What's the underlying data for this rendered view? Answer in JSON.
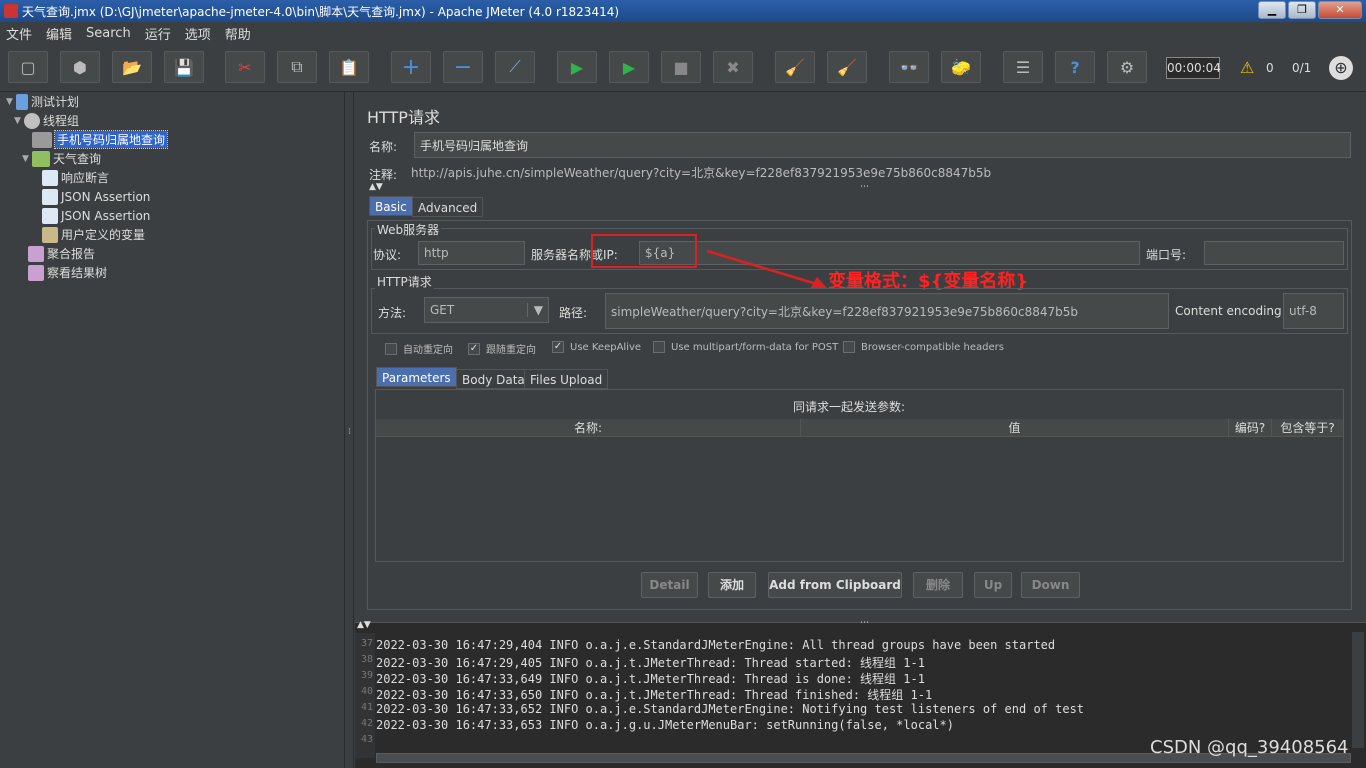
{
  "window": {
    "title": "天气查询.jmx (D:\\GJ\\jmeter\\apache-jmeter-4.0\\bin\\脚本\\天气查询.jmx) - Apache JMeter (4.0 r1823414)",
    "min_label": "▁",
    "max_label": "❐",
    "close_label": "✕"
  },
  "menu": {
    "items": [
      "文件",
      "编辑",
      "Search",
      "运行",
      "选项",
      "帮助"
    ]
  },
  "toolbar": {
    "icons": [
      "new-icon",
      "templates-icon",
      "open-icon",
      "save-icon",
      "cut-icon",
      "copy-icon",
      "paste-icon",
      "expand-icon",
      "collapse-icon",
      "toggle-icon",
      "start-icon",
      "start-no-pause-icon",
      "stop-icon",
      "shutdown-icon",
      "clear-icon",
      "clear-all-icon",
      "search-icon",
      "reset-search-icon",
      "function-helper-icon",
      "help-icon",
      "remote-icon"
    ],
    "glyphs": [
      "▢",
      "⬢",
      "📂",
      "💾",
      "✂",
      "⧉",
      "📋",
      "+",
      "−",
      "⟋",
      "▶",
      "▶",
      "■",
      "✖",
      "🧹",
      "🧹",
      "👓",
      "🧽",
      "☰",
      "?",
      "⚙"
    ],
    "timer": "00:00:04",
    "warning_count": "0",
    "thread_count": "0/1",
    "warning_glyph": "⚠",
    "globe_glyph": "⊕"
  },
  "tree": {
    "nodes": [
      {
        "label": "测试计划",
        "toggle": "▼",
        "color": "#6aa0e0"
      },
      {
        "label": "线程组",
        "toggle": "▼",
        "color": "#c0c0c0"
      },
      {
        "label": "手机号码归属地查询",
        "toggle": "",
        "color": "#9a9a9a"
      },
      {
        "label": "天气查询",
        "toggle": "▼",
        "color": "#8fbf5f"
      },
      {
        "label": "响应断言",
        "toggle": "",
        "color": "#dde8f5"
      },
      {
        "label": "JSON Assertion",
        "toggle": "",
        "color": "#dde8f5"
      },
      {
        "label": "JSON Assertion",
        "toggle": "",
        "color": "#dde8f5"
      },
      {
        "label": "用户定义的变量",
        "toggle": "",
        "color": "#c9b88a"
      },
      {
        "label": "聚合报告",
        "toggle": "",
        "color": "#c9a0d0"
      },
      {
        "label": "察看结果树",
        "toggle": "",
        "color": "#c9a0d0"
      }
    ]
  },
  "panel": {
    "heading": "HTTP请求",
    "name_label": "名称:",
    "name_value": "手机号码归属地查询",
    "comment_label": "注释:",
    "comment_value": "http://apis.juhe.cn/simpleWeather/query?city=北京&key=f228ef837921953e9e75b860c8847b5b",
    "tabs": [
      "Basic",
      "Advanced"
    ],
    "web_server": {
      "title": "Web服务器",
      "protocol_label": "协议:",
      "protocol_value": "http",
      "server_label": "服务器名称或IP:",
      "server_value": "${a}",
      "port_label": "端口号:",
      "port_value": ""
    },
    "http_request": {
      "title": "HTTP请求",
      "method_label": "方法:",
      "method_value": "GET",
      "path_label": "路径:",
      "path_value": "simpleWeather/query?city=北京&key=f228ef837921953e9e75b860c8847b5b",
      "encoding_label": "Content encoding:",
      "encoding_value": "utf-8"
    },
    "checkboxes": [
      {
        "label": "自动重定向",
        "checked": false
      },
      {
        "label": "跟随重定向",
        "checked": true
      },
      {
        "label": "Use KeepAlive",
        "checked": true
      },
      {
        "label": "Use multipart/form-data for POST",
        "checked": false
      },
      {
        "label": "Browser-compatible headers",
        "checked": false
      }
    ],
    "param_tabs": [
      "Parameters",
      "Body Data",
      "Files Upload"
    ],
    "params_caption": "同请求一起发送参数:",
    "columns": [
      "名称:",
      "值",
      "编码?",
      "包含等于?"
    ],
    "buttons": [
      "Detail",
      "添加",
      "Add from Clipboard",
      "删除",
      "Up",
      "Down"
    ],
    "annotation": "变量格式：${变量名称}"
  },
  "log": {
    "lines": [
      {
        "n": "37",
        "text": "2022-03-30 16:47:29,404 INFO o.a.j.e.StandardJMeterEngine: All thread groups have been started"
      },
      {
        "n": "38",
        "text": "2022-03-30 16:47:29,405 INFO o.a.j.t.JMeterThread: Thread started: 线程组 1-1"
      },
      {
        "n": "39",
        "text": "2022-03-30 16:47:33,649 INFO o.a.j.t.JMeterThread: Thread is done: 线程组 1-1"
      },
      {
        "n": "40",
        "text": "2022-03-30 16:47:33,650 INFO o.a.j.t.JMeterThread: Thread finished: 线程组 1-1"
      },
      {
        "n": "41",
        "text": "2022-03-30 16:47:33,652 INFO o.a.j.e.StandardJMeterEngine: Notifying test listeners of end of test"
      },
      {
        "n": "42",
        "text": "2022-03-30 16:47:33,653 INFO o.a.j.g.u.JMeterMenuBar: setRunning(false, *local*)"
      },
      {
        "n": "43",
        "text": ""
      }
    ]
  },
  "watermark": "CSDN @qq_39408564"
}
